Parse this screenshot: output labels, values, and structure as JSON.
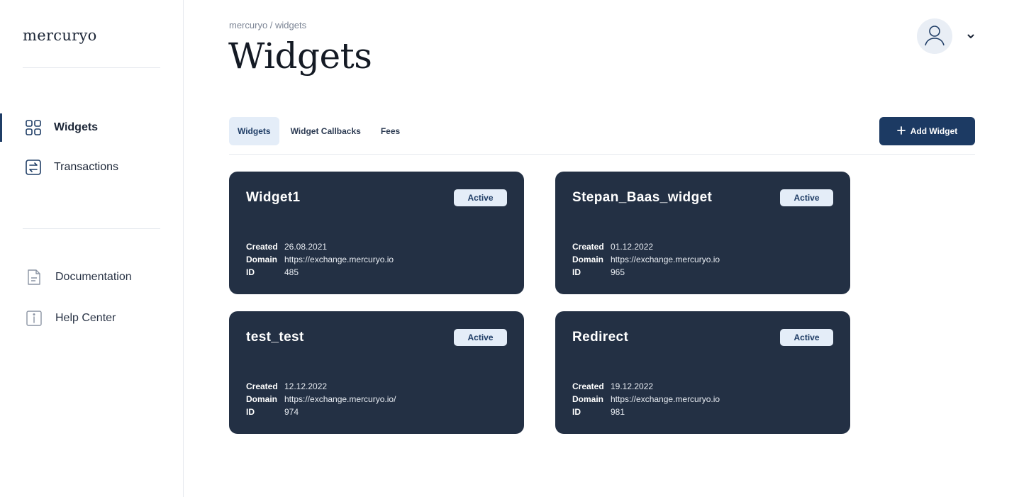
{
  "sidebar": {
    "logo": "mercuryo",
    "nav": [
      {
        "label": "Widgets",
        "icon": "grid-icon",
        "active": true
      },
      {
        "label": "Transactions",
        "icon": "transactions-icon",
        "active": false
      }
    ],
    "secondary": [
      {
        "label": "Documentation",
        "icon": "document-icon"
      },
      {
        "label": "Help Center",
        "icon": "info-icon"
      }
    ]
  },
  "header": {
    "breadcrumb": "mercuryo / widgets",
    "title": "Widgets",
    "avatar_icon": "user-icon",
    "menu_icon": "chevron-down-icon"
  },
  "tabs": [
    {
      "label": "Widgets",
      "active": true
    },
    {
      "label": "Widget Callbacks",
      "active": false
    },
    {
      "label": "Fees",
      "active": false
    }
  ],
  "actions": {
    "add_widget": "Add Widget",
    "add_icon": "plus-icon"
  },
  "field_labels": {
    "created": "Created",
    "domain": "Domain",
    "id": "ID"
  },
  "widgets": [
    {
      "name": "Widget1",
      "status": "Active",
      "created": "26.08.2021",
      "domain": "https://exchange.mercuryo.io",
      "id": "485"
    },
    {
      "name": "Stepan_Baas_widget",
      "status": "Active",
      "created": "01.12.2022",
      "domain": "https://exchange.mercuryo.io",
      "id": "965"
    },
    {
      "name": "test_test",
      "status": "Active",
      "created": "12.12.2022",
      "domain": "https://exchange.mercuryo.io/",
      "id": "974"
    },
    {
      "name": "Redirect",
      "status": "Active",
      "created": "19.12.2022",
      "domain": "https://exchange.mercuryo.io",
      "id": "981"
    }
  ],
  "colors": {
    "accent": "#1c3a63",
    "card_bg": "#233044",
    "badge_bg": "#e4edf8",
    "active_tab_bg": "#e4edf8"
  }
}
